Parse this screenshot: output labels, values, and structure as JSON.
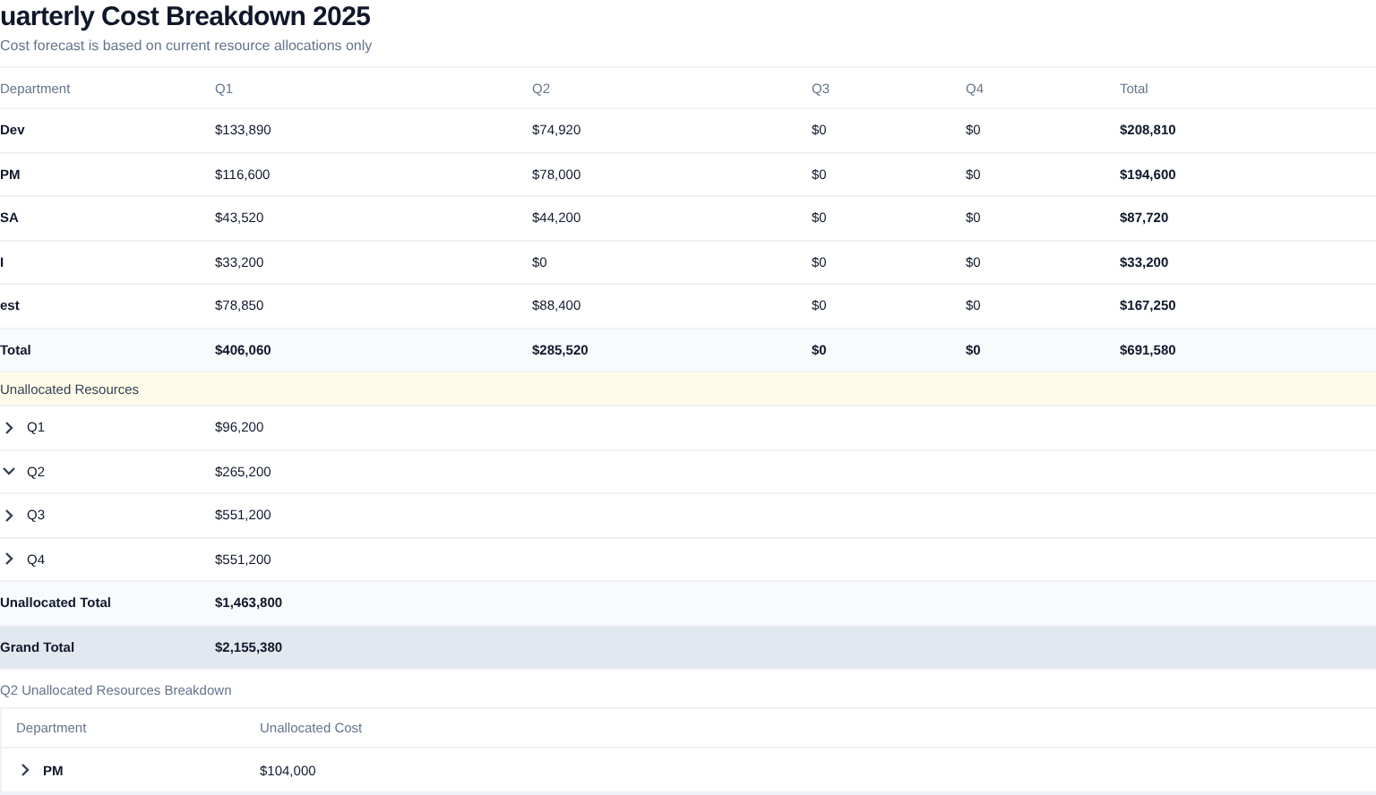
{
  "title": "uarterly Cost Breakdown 2025",
  "subtitle": "Cost forecast is based on current resource allocations only",
  "table": {
    "columns": [
      "Department",
      "Q1",
      "Q2",
      "Q3",
      "Q4",
      "Total"
    ],
    "rows": [
      {
        "cells": [
          "Dev",
          "$133,890",
          "$74,920",
          "$0",
          "$0",
          "$208,810"
        ]
      },
      {
        "cells": [
          "PM",
          "$116,600",
          "$78,000",
          "$0",
          "$0",
          "$194,600"
        ]
      },
      {
        "cells": [
          "SA",
          "$43,520",
          "$44,200",
          "$0",
          "$0",
          "$87,720"
        ]
      },
      {
        "cells": [
          "I",
          "$33,200",
          "$0",
          "$0",
          "$0",
          "$33,200"
        ]
      },
      {
        "cells": [
          "est",
          "$78,850",
          "$88,400",
          "$0",
          "$0",
          "$167,250"
        ]
      }
    ],
    "total_row": [
      "Total",
      "$406,060",
      "$285,520",
      "$0",
      "$0",
      "$691,580"
    ]
  },
  "unallocated": {
    "heading": "Unallocated Resources",
    "quarters": [
      {
        "label": "Q1",
        "value": "$96,200",
        "expanded": false
      },
      {
        "label": "Q2",
        "value": "$265,200",
        "expanded": true
      },
      {
        "label": "Q3",
        "value": "$551,200",
        "expanded": false
      },
      {
        "label": "Q4",
        "value": "$551,200",
        "expanded": false
      }
    ],
    "total": {
      "label": "Unallocated Total",
      "value": "$1,463,800"
    }
  },
  "grand_total": {
    "label": "Grand Total",
    "value": "$2,155,380"
  },
  "breakdown": {
    "title": "Q2 Unallocated Resources Breakdown",
    "columns": [
      "Department",
      "Unallocated Cost"
    ],
    "rows": [
      {
        "department": "PM",
        "value": "$104,000",
        "expanded": false
      }
    ]
  }
}
